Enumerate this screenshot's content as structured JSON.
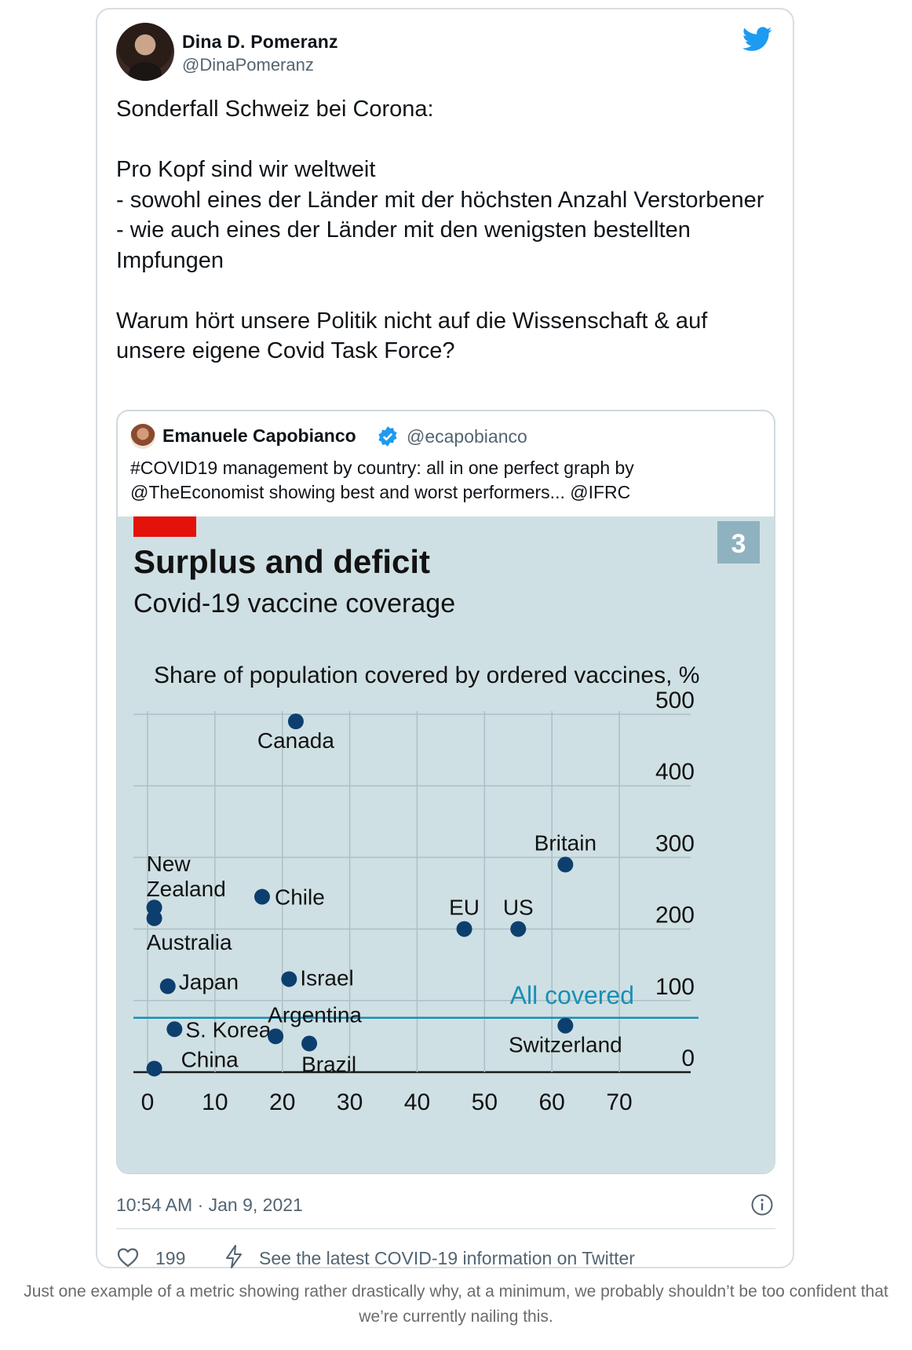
{
  "tweet": {
    "author_name": "Dina D. Pomeranz",
    "author_handle": "@DinaPomeranz",
    "text": "Sonderfall Schweiz bei Corona:\n\nPro Kopf sind wir weltweit\n- sowohl eines der Länder mit der höchsten Anzahl Verstorbener\n- wie auch eines der Länder mit den wenigsten bestellten Impfungen\n\nWarum hört unsere Politik nicht auf die Wissenschaft & auf unsere eigene Covid Task Force?",
    "timestamp": "10:54 AM · Jan 9, 2021",
    "likes": "199",
    "covid_link": "See the latest COVID-19 information on Twitter"
  },
  "quoted": {
    "author_name": "Emanuele Capobianco",
    "author_handle": "@ecapobianco",
    "text": "#COVID19 management by country: all in one perfect graph by @TheEconomist showing best and worst performers... @IFRC"
  },
  "chart_data": {
    "type": "scatter",
    "title": "Surplus and deficit",
    "subtitle": "Covid-19 vaccine coverage",
    "chart_number": "3",
    "ylabel": "Share of population covered by ordered vaccines, %",
    "xlim": [
      0,
      75
    ],
    "ylim": [
      0,
      500
    ],
    "yticks": [
      "0",
      "100",
      "200",
      "300",
      "400",
      "500"
    ],
    "xticks": [
      "0",
      "10",
      "20",
      "30",
      "40",
      "50",
      "60",
      "70"
    ],
    "reference_line": {
      "y": 100,
      "label": "All covered"
    },
    "points": [
      {
        "label": "Canada",
        "x": 22,
        "y": 490
      },
      {
        "label": "Britain",
        "x": 62,
        "y": 290
      },
      {
        "label": "New Zealand",
        "x": 1,
        "y": 230
      },
      {
        "label": "Australia",
        "x": 1,
        "y": 215
      },
      {
        "label": "Chile",
        "x": 17,
        "y": 245
      },
      {
        "label": "EU",
        "x": 47,
        "y": 200
      },
      {
        "label": "US",
        "x": 55,
        "y": 200
      },
      {
        "label": "Japan",
        "x": 3,
        "y": 120
      },
      {
        "label": "Israel",
        "x": 21,
        "y": 130
      },
      {
        "label": "S. Korea",
        "x": 4,
        "y": 60
      },
      {
        "label": "Argentina",
        "x": 19,
        "y": 50
      },
      {
        "label": "Brazil",
        "x": 24,
        "y": 40
      },
      {
        "label": "Switzerland",
        "x": 62,
        "y": 65
      },
      {
        "label": "China",
        "x": 1,
        "y": 5
      }
    ],
    "colors": {
      "dot": "#0d3f6e",
      "reference": "#1a8fb5",
      "flag": "#e3120b",
      "background": "#c9dde3"
    }
  },
  "caption": "Just one example of a metric showing rather drastically why, at a minimum, we probably shouldn’t be too confident that we’re currently nailing this."
}
